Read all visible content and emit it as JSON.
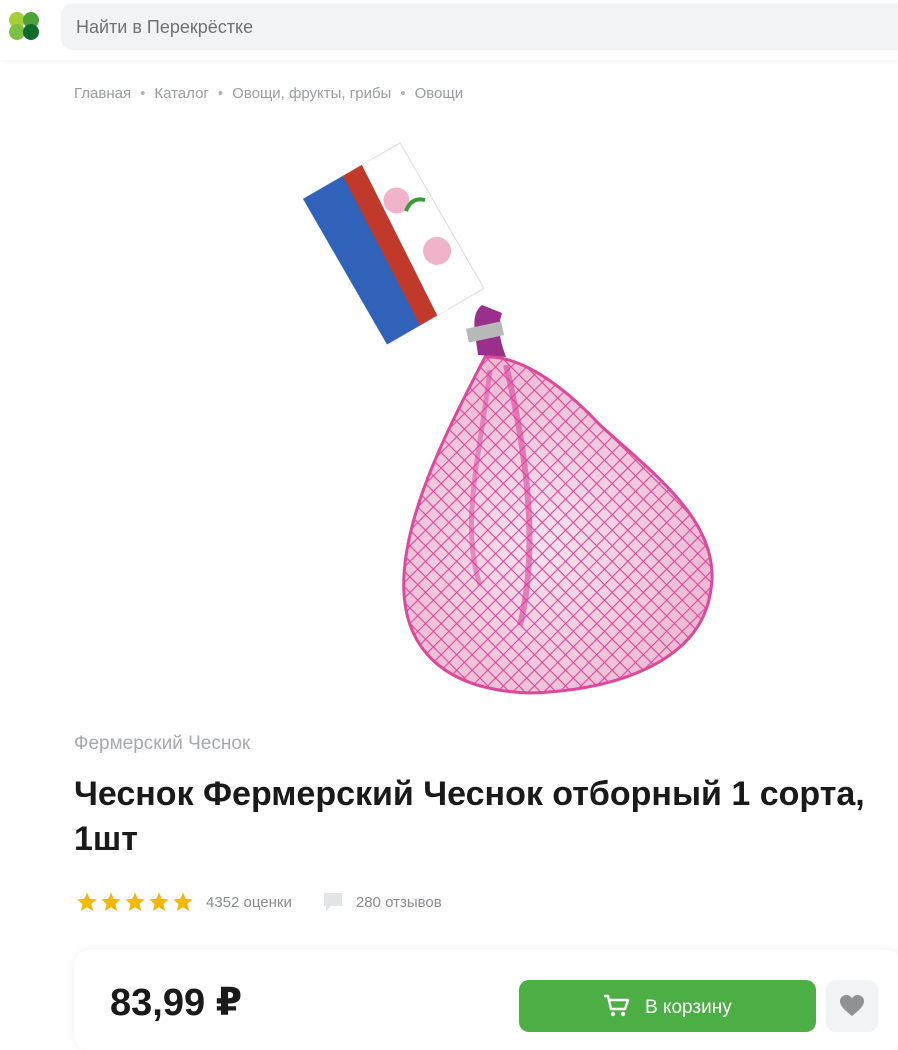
{
  "header": {
    "logo": "perekrestok-clover-logo",
    "search": {
      "placeholder": "Найти в Перекрёстке"
    }
  },
  "breadcrumb": [
    "Главная",
    "Каталог",
    "Овощи, фрукты, грибы",
    "Овощи"
  ],
  "product": {
    "image": "garlic-in-pink-net-icon",
    "brand": "Фермерский Чеснок",
    "title": "Чеснок Фермерский Чеснок отборный 1 сорта, 1шт",
    "rating": {
      "stars": 5,
      "max_stars": 5,
      "ratings_label": "4352 оценки",
      "reviews_label": "280 отзывов"
    },
    "price": "83,99 ₽",
    "cart_label": "В корзину"
  },
  "colors": {
    "accent_green": "#4caf45",
    "star_yellow": "#f5b800",
    "net_pink": "#e0479b"
  }
}
